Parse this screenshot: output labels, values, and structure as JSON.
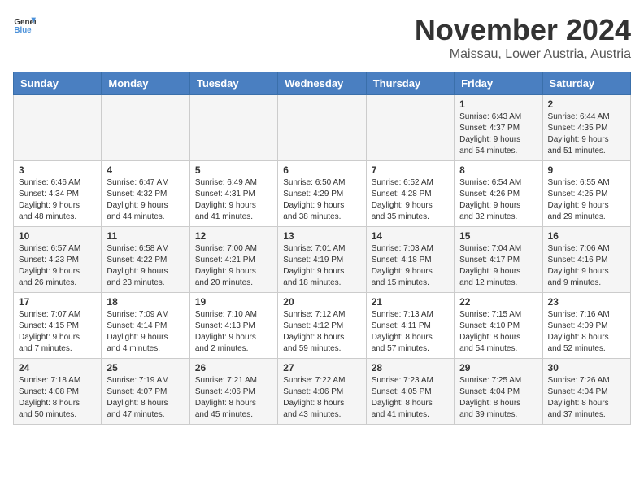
{
  "header": {
    "logo_general": "General",
    "logo_blue": "Blue",
    "month_title": "November 2024",
    "location": "Maissau, Lower Austria, Austria"
  },
  "days_of_week": [
    "Sunday",
    "Monday",
    "Tuesday",
    "Wednesday",
    "Thursday",
    "Friday",
    "Saturday"
  ],
  "weeks": [
    [
      {
        "day": "",
        "info": ""
      },
      {
        "day": "",
        "info": ""
      },
      {
        "day": "",
        "info": ""
      },
      {
        "day": "",
        "info": ""
      },
      {
        "day": "",
        "info": ""
      },
      {
        "day": "1",
        "info": "Sunrise: 6:43 AM\nSunset: 4:37 PM\nDaylight: 9 hours\nand 54 minutes."
      },
      {
        "day": "2",
        "info": "Sunrise: 6:44 AM\nSunset: 4:35 PM\nDaylight: 9 hours\nand 51 minutes."
      }
    ],
    [
      {
        "day": "3",
        "info": "Sunrise: 6:46 AM\nSunset: 4:34 PM\nDaylight: 9 hours\nand 48 minutes."
      },
      {
        "day": "4",
        "info": "Sunrise: 6:47 AM\nSunset: 4:32 PM\nDaylight: 9 hours\nand 44 minutes."
      },
      {
        "day": "5",
        "info": "Sunrise: 6:49 AM\nSunset: 4:31 PM\nDaylight: 9 hours\nand 41 minutes."
      },
      {
        "day": "6",
        "info": "Sunrise: 6:50 AM\nSunset: 4:29 PM\nDaylight: 9 hours\nand 38 minutes."
      },
      {
        "day": "7",
        "info": "Sunrise: 6:52 AM\nSunset: 4:28 PM\nDaylight: 9 hours\nand 35 minutes."
      },
      {
        "day": "8",
        "info": "Sunrise: 6:54 AM\nSunset: 4:26 PM\nDaylight: 9 hours\nand 32 minutes."
      },
      {
        "day": "9",
        "info": "Sunrise: 6:55 AM\nSunset: 4:25 PM\nDaylight: 9 hours\nand 29 minutes."
      }
    ],
    [
      {
        "day": "10",
        "info": "Sunrise: 6:57 AM\nSunset: 4:23 PM\nDaylight: 9 hours\nand 26 minutes."
      },
      {
        "day": "11",
        "info": "Sunrise: 6:58 AM\nSunset: 4:22 PM\nDaylight: 9 hours\nand 23 minutes."
      },
      {
        "day": "12",
        "info": "Sunrise: 7:00 AM\nSunset: 4:21 PM\nDaylight: 9 hours\nand 20 minutes."
      },
      {
        "day": "13",
        "info": "Sunrise: 7:01 AM\nSunset: 4:19 PM\nDaylight: 9 hours\nand 18 minutes."
      },
      {
        "day": "14",
        "info": "Sunrise: 7:03 AM\nSunset: 4:18 PM\nDaylight: 9 hours\nand 15 minutes."
      },
      {
        "day": "15",
        "info": "Sunrise: 7:04 AM\nSunset: 4:17 PM\nDaylight: 9 hours\nand 12 minutes."
      },
      {
        "day": "16",
        "info": "Sunrise: 7:06 AM\nSunset: 4:16 PM\nDaylight: 9 hours\nand 9 minutes."
      }
    ],
    [
      {
        "day": "17",
        "info": "Sunrise: 7:07 AM\nSunset: 4:15 PM\nDaylight: 9 hours\nand 7 minutes."
      },
      {
        "day": "18",
        "info": "Sunrise: 7:09 AM\nSunset: 4:14 PM\nDaylight: 9 hours\nand 4 minutes."
      },
      {
        "day": "19",
        "info": "Sunrise: 7:10 AM\nSunset: 4:13 PM\nDaylight: 9 hours\nand 2 minutes."
      },
      {
        "day": "20",
        "info": "Sunrise: 7:12 AM\nSunset: 4:12 PM\nDaylight: 8 hours\nand 59 minutes."
      },
      {
        "day": "21",
        "info": "Sunrise: 7:13 AM\nSunset: 4:11 PM\nDaylight: 8 hours\nand 57 minutes."
      },
      {
        "day": "22",
        "info": "Sunrise: 7:15 AM\nSunset: 4:10 PM\nDaylight: 8 hours\nand 54 minutes."
      },
      {
        "day": "23",
        "info": "Sunrise: 7:16 AM\nSunset: 4:09 PM\nDaylight: 8 hours\nand 52 minutes."
      }
    ],
    [
      {
        "day": "24",
        "info": "Sunrise: 7:18 AM\nSunset: 4:08 PM\nDaylight: 8 hours\nand 50 minutes."
      },
      {
        "day": "25",
        "info": "Sunrise: 7:19 AM\nSunset: 4:07 PM\nDaylight: 8 hours\nand 47 minutes."
      },
      {
        "day": "26",
        "info": "Sunrise: 7:21 AM\nSunset: 4:06 PM\nDaylight: 8 hours\nand 45 minutes."
      },
      {
        "day": "27",
        "info": "Sunrise: 7:22 AM\nSunset: 4:06 PM\nDaylight: 8 hours\nand 43 minutes."
      },
      {
        "day": "28",
        "info": "Sunrise: 7:23 AM\nSunset: 4:05 PM\nDaylight: 8 hours\nand 41 minutes."
      },
      {
        "day": "29",
        "info": "Sunrise: 7:25 AM\nSunset: 4:04 PM\nDaylight: 8 hours\nand 39 minutes."
      },
      {
        "day": "30",
        "info": "Sunrise: 7:26 AM\nSunset: 4:04 PM\nDaylight: 8 hours\nand 37 minutes."
      }
    ]
  ]
}
